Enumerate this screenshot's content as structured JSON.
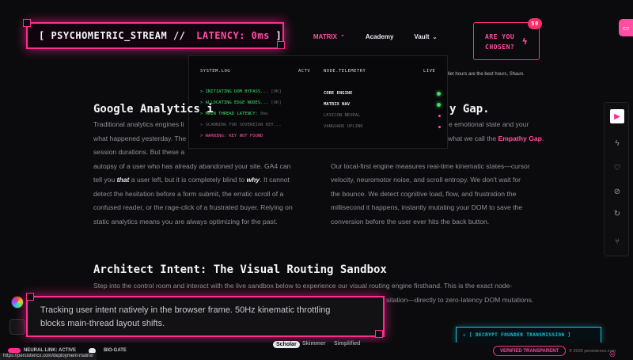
{
  "nav": {
    "items": [
      {
        "label": "",
        "active": false
      },
      {
        "label": "MATRIX",
        "active": true
      },
      {
        "label": "Academy",
        "active": false
      },
      {
        "label": "Vault",
        "active": false
      }
    ]
  },
  "stream": {
    "prefix": "[ PSYCHOMETRIC_STREAM // ",
    "latency": "LATENCY: 0ms",
    "suffix": " ]"
  },
  "cta": {
    "line1": "ARE YOU",
    "line2": "CHOSEN?",
    "badge": "50"
  },
  "hint": "llet hours are the best hours, Shaun.",
  "dropdown": {
    "sys_header": "SYSTEM.LOG",
    "sys_status": "ACTV",
    "node_header": "NODE.TELEMETRY",
    "node_status": "LIVE",
    "logs": [
      {
        "text": "> INITIATING DOM BYPASS...",
        "tag": " [OK]",
        "state": "ok"
      },
      {
        "text": "> ALLOCATING EDGE NODES...",
        "tag": " [OK]",
        "state": "ok"
      },
      {
        "text": "> MAIN THREAD LATENCY:",
        "tag": " 0ms",
        "state": "ok"
      },
      {
        "text": "> SCANNING FOR SOVEREIGN KEY...",
        "tag": "",
        "state": "dim"
      },
      {
        "text": "> WARNING: KEY NOT FOUND",
        "tag": "",
        "state": "err"
      }
    ],
    "nodes": [
      {
        "name": "CORE ENGINE",
        "state": "live"
      },
      {
        "name": "MATRIX NAV",
        "state": "live"
      },
      {
        "name": "LEXICON NEURAL",
        "state": "idle"
      },
      {
        "name": "VANGUARD UPLINK",
        "state": "idle"
      }
    ]
  },
  "section1": {
    "title_left": "Google Analytics i",
    "title_right": "y Gap.",
    "left": {
      "l1": "Traditional analytics engines li",
      "l2": "what happened yesterday. The",
      "l3": "session durations. But these a",
      "l4": "autopsy of a user who has already abandoned your site. GA4 can",
      "l5a": "tell you ",
      "l5b": "that",
      "l5c": " a user left, but it is completely blind to ",
      "l5d": "why",
      "l5e": ". It cannot",
      "l6": "detect the hesitation before a form submit, the erratic scroll of a",
      "l7": "confused reader, or the rage-click of a frustrated buyer. Relying on",
      "l8": "static analytics means you are always optimizing for the past."
    },
    "right": {
      "r1": "e emotional state and your",
      "r2a": "what we call the ",
      "r2b": "Empathy Gap",
      "r2c": ".",
      "r4": "Our local-first engine measures real-time kinematic states—cursor",
      "r5": "velocity, neuromotor noise, and scroll entropy. We don't wait for",
      "r6": "the bounce. We detect cognitive load, flow, and frustration the",
      "r7": "millisecond it happens, instantly mutating your DOM to save the",
      "r8": "conversion before the user ever hits the back button."
    }
  },
  "section2": {
    "title": "Architect Intent: The Visual Routing Sandbox",
    "l1": "Step into the control room and interact with the live sandbox below to experience our visual routing engine firsthand. This is the exact node-",
    "l2": "sitation—directly to zero-latency DOM mutations."
  },
  "tracking": {
    "text1": "Tracking user intent natively in the browser frame. 50Hz kinematic throttling",
    "text2": "blocks main-thread layout shifts."
  },
  "decrypt": "✳ [ DECRYPT FOUNDER TRANSMISSION ]",
  "modes": [
    "Scholar",
    "Skimmer",
    "Simplified"
  ],
  "toggles": {
    "left": "NEURAL LINK: ACTIVE",
    "right": "BIO-GATE"
  },
  "verified": "VERIFIED TRANSPARENT",
  "copyright": "© 2026 persistencx.com",
  "status_url": "https://persistencx.com/deployment-matrix/",
  "colors": {
    "accent": "#ff2d92",
    "accent_text": "#ff4fa3",
    "success": "#3ddc6a",
    "cyan": "#19c2e0",
    "background": "#0b0b0d"
  },
  "icons": {
    "rail": [
      "play-icon",
      "bolt-icon",
      "heartbeat-icon",
      "eye-off-icon",
      "refresh-icon",
      "branch-icon"
    ],
    "left": [
      "color-wheel-icon",
      "vr-headset-icon"
    ],
    "globe": "globe-icon"
  }
}
